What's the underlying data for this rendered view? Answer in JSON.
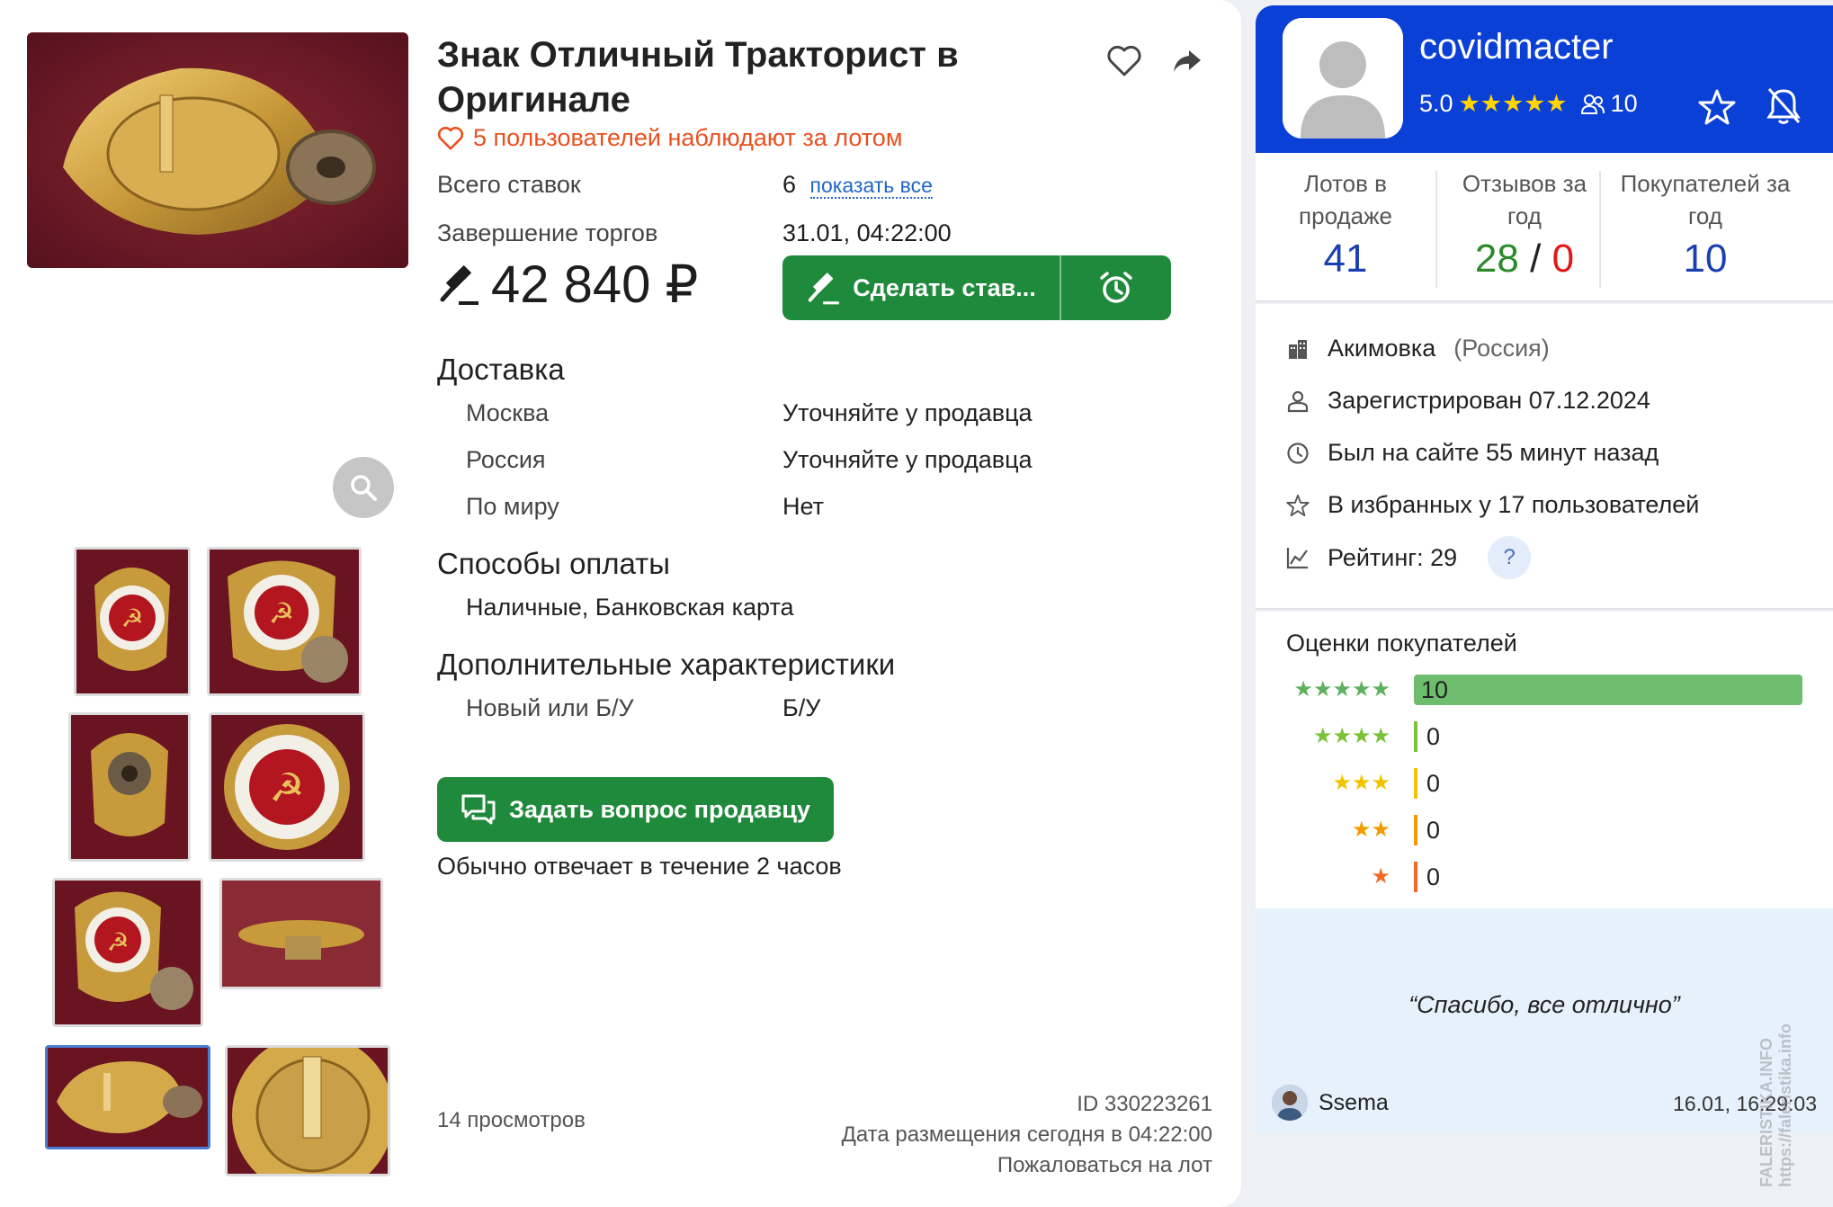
{
  "product": {
    "title": "Знак Отличный Тракторист в Оригинале",
    "watchers_text": "5 пользователей наблюдают за лотом",
    "bids_label": "Всего ставок",
    "bids_count": "6",
    "show_all_label": "показать все",
    "end_label": "Завершение торгов",
    "end_value": "31.01, 04:22:00",
    "price": "42 840 ₽",
    "bid_button_label": "Сделать став...",
    "delivery": {
      "heading": "Доставка",
      "rows": [
        {
          "place": "Москва",
          "value": "Уточняйте у продавца"
        },
        {
          "place": "Россия",
          "value": "Уточняйте у продавца"
        },
        {
          "place": "По миру",
          "value": "Нет"
        }
      ]
    },
    "payment": {
      "heading": "Способы оплаты",
      "value": "Наличные, Банковская карта"
    },
    "extra": {
      "heading": "Дополнительные характеристики",
      "label": "Новый или Б/У",
      "value": "Б/У"
    },
    "ask_button_label": "Задать вопрос продавцу",
    "ask_note": "Обычно отвечает в течение 2 часов",
    "views": "14 просмотров",
    "id_text": "ID 330223261",
    "posted_text": "Дата размещения сегодня в 04:22:00",
    "report_text": "Пожаловаться на лот"
  },
  "seller": {
    "name": "covidmacter",
    "rating": "5.0",
    "followers": "10",
    "stats": [
      {
        "label": "Лотов в продаже",
        "value": "41",
        "color": "#1a3fb0"
      },
      {
        "label": "Отзывов за год",
        "positive": "28",
        "separator": "/",
        "negative": "0"
      },
      {
        "label": "Покупателей за год",
        "value": "10",
        "color": "#1a3fb0"
      }
    ],
    "info": {
      "city": "Акимовка",
      "country": "(Россия)",
      "registered": "Зарегистрирован 07.12.2024",
      "last_seen": "Был на сайте 55 минут назад",
      "favorites": "В избранных у 17 пользователей",
      "rating_text": "Рейтинг: 29",
      "help": "?"
    },
    "ratings": {
      "heading": "Оценки покупателей",
      "rows": [
        {
          "stars": "★★★★★",
          "count": "10",
          "color": "#5eb05e"
        },
        {
          "stars": "★★★★",
          "count": "0",
          "color": "#7ac23a"
        },
        {
          "stars": "★★★",
          "count": "0",
          "color": "#f0c400"
        },
        {
          "stars": "★★",
          "count": "0",
          "color": "#f29a00"
        },
        {
          "stars": "★",
          "count": "0",
          "color": "#f26a2a"
        }
      ]
    },
    "review": {
      "text": "“Спасибо, все отлично”",
      "author": "Ssema",
      "date": "16.01, 16:29:03"
    }
  },
  "watermark": "FALERISTIKA.INFO https://faleristika.info"
}
